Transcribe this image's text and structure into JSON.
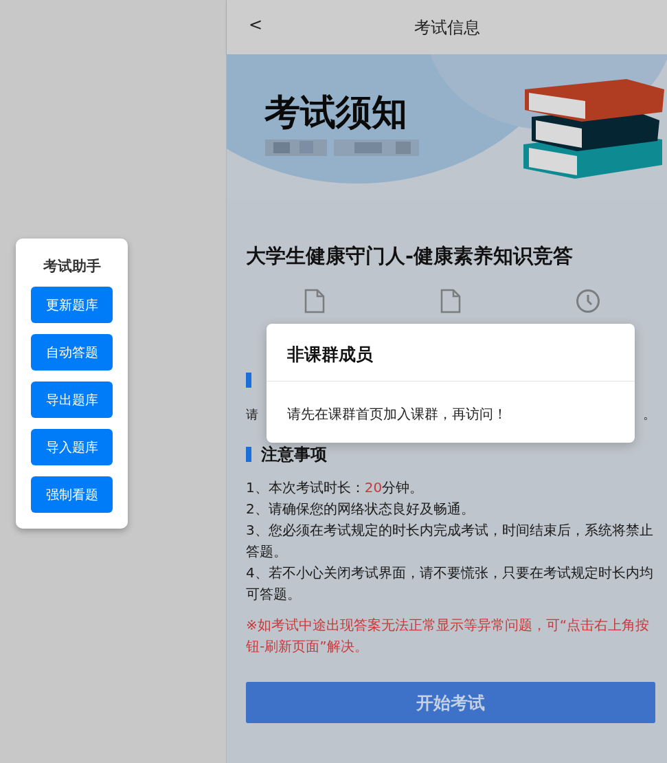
{
  "assistant_panel": {
    "title": "考试助手",
    "buttons": [
      "更新题库",
      "自动答题",
      "导出题库",
      "导入题库",
      "强制看题"
    ]
  },
  "header": {
    "back": "<",
    "title": "考试信息"
  },
  "banner": {
    "title": "考试须知"
  },
  "exam": {
    "title": "大学生健康守门人-健康素养知识竞答",
    "stats": [
      {
        "kind": "file"
      },
      {
        "kind": "file"
      },
      {
        "kind": "clock"
      }
    ]
  },
  "covered_section": {
    "fragment_start": "请",
    "fragment_end": "。"
  },
  "notes": {
    "heading": "注意事项",
    "items": [
      {
        "kind": "duration",
        "prefix": "1、本次考试时长：",
        "highlight": "20",
        "suffix": "分钟。"
      },
      {
        "kind": "plain",
        "text": "2、请确保您的网络状态良好及畅通。"
      },
      {
        "kind": "plain",
        "text": "3、您必须在考试规定的时长内完成考试，时间结束后，系统将禁止答题。"
      },
      {
        "kind": "plain",
        "text": "4、若不小心关闭考试界面，请不要慌张，只要在考试规定时长内均可答题。"
      }
    ],
    "warning": "※如考试中途出现答案无法正常显示等异常问题，可“点击右上角按钮-刷新页面”解决。"
  },
  "start_button": "开始考试",
  "dialog": {
    "title": "非课群成员",
    "message": "请先在课群首页加入课群，再访问！"
  }
}
